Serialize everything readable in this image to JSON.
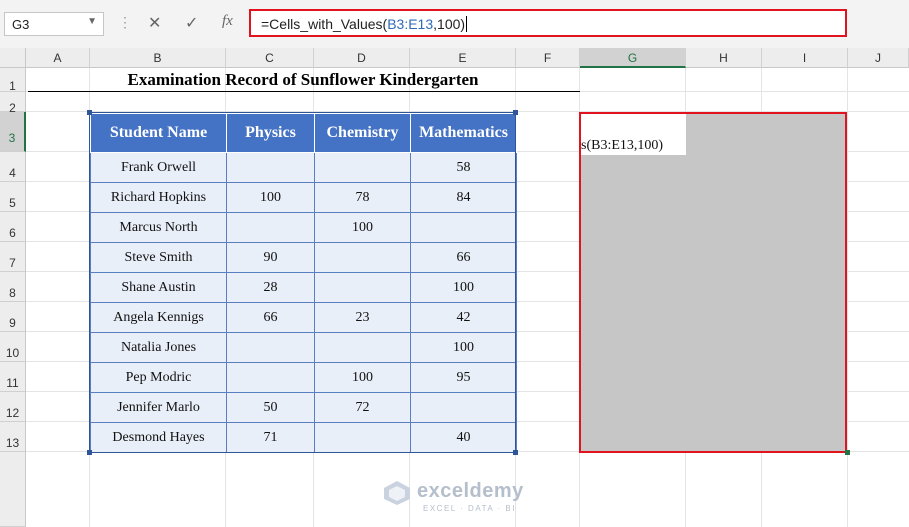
{
  "formula_bar": {
    "name_box": "G3",
    "cancel_icon": "✕",
    "enter_icon": "✓",
    "fx_label": "fx",
    "formula_prefix": "=Cells_with_Values(",
    "formula_ref": "B3:E13",
    "formula_suffix": ",100)"
  },
  "columns": [
    "A",
    "B",
    "C",
    "D",
    "E",
    "F",
    "G",
    "H",
    "I",
    "J"
  ],
  "selected_column": "G",
  "rows": [
    "1",
    "2",
    "3",
    "4",
    "5",
    "6",
    "7",
    "8",
    "9",
    "10",
    "11",
    "12",
    "13"
  ],
  "selected_row": "3",
  "title": "Examination Record of Sunflower Kindergarten",
  "table": {
    "headers": [
      "Student Name",
      "Physics",
      "Chemistry",
      "Mathematics"
    ],
    "rows": [
      [
        "Frank Orwell",
        "",
        "",
        "58"
      ],
      [
        "Richard Hopkins",
        "100",
        "78",
        "84"
      ],
      [
        "Marcus North",
        "",
        "100",
        ""
      ],
      [
        "Steve Smith",
        "90",
        "",
        "66"
      ],
      [
        "Shane Austin",
        "28",
        "",
        "100"
      ],
      [
        "Angela Kennigs",
        "66",
        "23",
        "42"
      ],
      [
        "Natalia Jones",
        "",
        "",
        "100"
      ],
      [
        "Pep Modric",
        "",
        "100",
        "95"
      ],
      [
        "Jennifer Marlo",
        "50",
        "72",
        ""
      ],
      [
        "Desmond Hayes",
        "71",
        "",
        "40"
      ]
    ]
  },
  "output_cell_text": "s(B3:E13,100)",
  "watermark": {
    "name": "exceldemy",
    "tagline": "EXCEL · DATA · BI"
  },
  "colors": {
    "header_blue": "#4472c4",
    "highlight_red": "#e0131e",
    "excel_green": "#217346"
  }
}
